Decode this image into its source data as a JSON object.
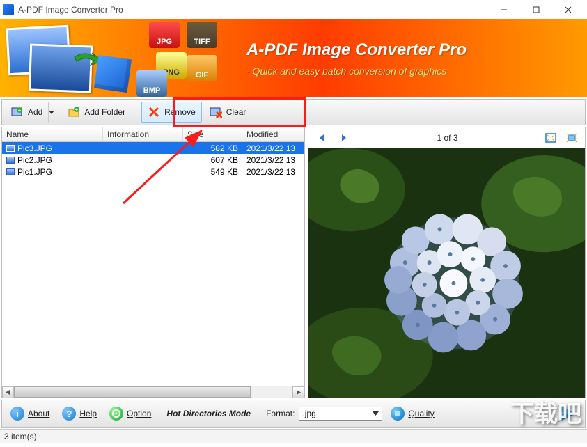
{
  "window": {
    "title": "A-PDF Image Converter Pro"
  },
  "banner": {
    "title": "A-PDF Image Converter Pro",
    "subtitle": "- Quick and easy batch conversion of graphics",
    "filetypes": {
      "jpg": "JPG",
      "tiff": "TIFF",
      "png": "PNG",
      "bmp": "BMP",
      "gif": "GIF"
    }
  },
  "toolbar": {
    "add": "Add",
    "add_folder": "Add Folder",
    "remove": "Remove",
    "clear": "Clear"
  },
  "list": {
    "headers": {
      "name": "Name",
      "info": "Information",
      "size": "Size",
      "modified": "Modified"
    },
    "rows": [
      {
        "name": "Pic3.JPG",
        "info": "",
        "size": "582 KB",
        "modified": "2021/3/22 13",
        "selected": true
      },
      {
        "name": "Pic2.JPG",
        "info": "",
        "size": "607 KB",
        "modified": "2021/3/22 13",
        "selected": false
      },
      {
        "name": "Pic1.JPG",
        "info": "",
        "size": "549 KB",
        "modified": "2021/3/22 13",
        "selected": false
      }
    ]
  },
  "preview": {
    "counter": "1 of 3"
  },
  "bottom": {
    "about": "About",
    "help": "Help",
    "option": "Option",
    "mode": "Hot Directories Mode",
    "format_label": "Format:",
    "format_value": ".jpg",
    "quality": "Quality"
  },
  "status": {
    "items": "3 item(s)"
  },
  "watermark": "下载吧"
}
